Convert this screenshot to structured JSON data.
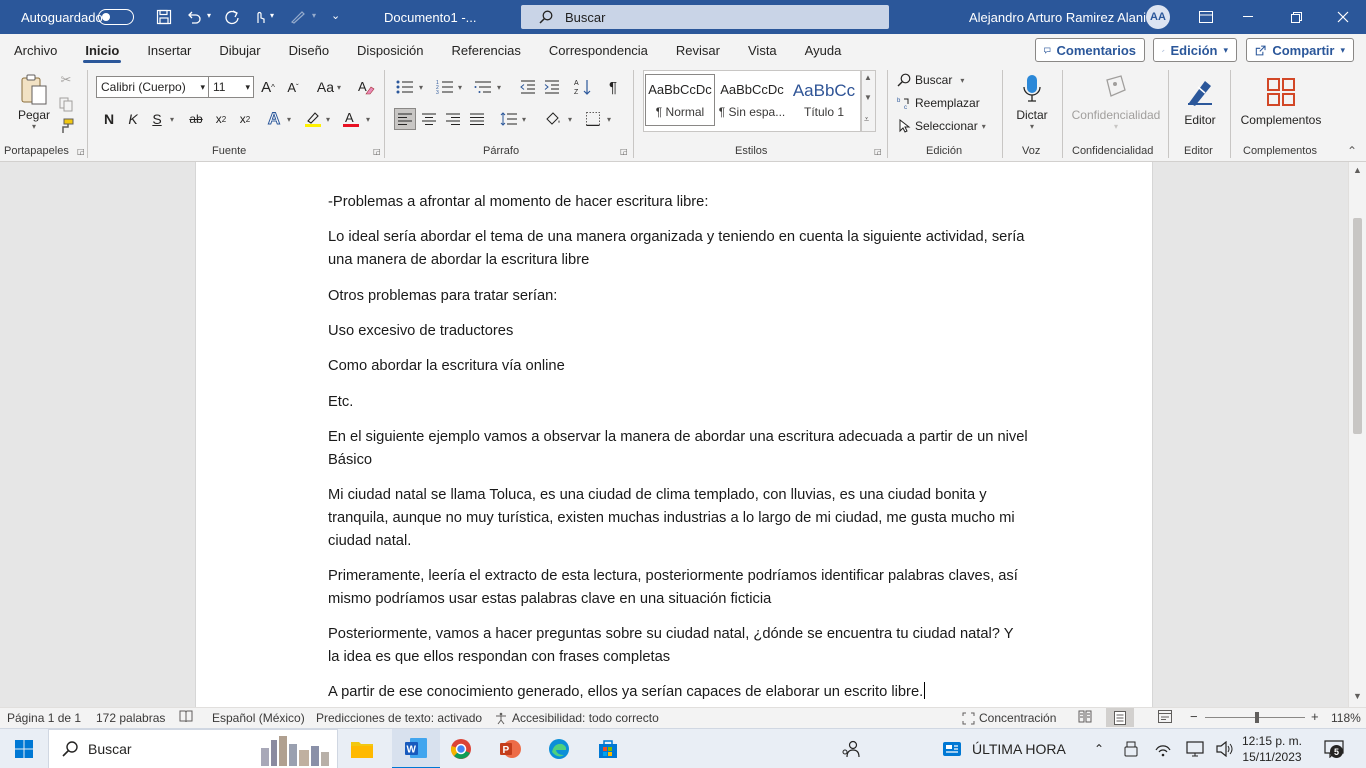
{
  "titlebar": {
    "autosave_label": "Autoguardado",
    "doc_title": "Documento1  -...",
    "search_placeholder": "Buscar",
    "user_name": "Alejandro Arturo Ramirez Alanis",
    "user_initials": "AA",
    "accent": "#2b579a"
  },
  "menu": {
    "tabs": [
      "Archivo",
      "Inicio",
      "Insertar",
      "Dibujar",
      "Diseño",
      "Disposición",
      "Referencias",
      "Correspondencia",
      "Revisar",
      "Vista",
      "Ayuda"
    ],
    "active_tab": "Inicio",
    "comments_label": "Comentarios",
    "editing_label": "Edición",
    "share_label": "Compartir"
  },
  "ribbon": {
    "paste_label": "Pegar",
    "font_name": "Calibri (Cuerpo)",
    "font_size": "11",
    "bold": "N",
    "italic": "K",
    "underline": "S",
    "case_label": "Aa",
    "styles": [
      {
        "preview": "AaBbCcDc",
        "label": "¶ Normal"
      },
      {
        "preview": "AaBbCcDc",
        "label": "¶ Sin espa..."
      },
      {
        "preview": "AaBbCc",
        "label": "Título 1"
      }
    ],
    "find_label": "Buscar",
    "replace_label": "Reemplazar",
    "select_label": "Seleccionar",
    "dictate_label": "Dictar",
    "sensitivity_label": "Confidencialidad",
    "editor_label": "Editor",
    "addins_label": "Complementos",
    "groups": {
      "clipboard": "Portapapeles",
      "font": "Fuente",
      "paragraph": "Párrafo",
      "styles": "Estilos",
      "editing": "Edición",
      "voice": "Voz",
      "sensitivity": "Confidencialidad",
      "editor": "Editor",
      "addins": "Complementos"
    }
  },
  "document": {
    "paragraphs": [
      "-Problemas a afrontar al momento de hacer escritura libre:",
      "Lo ideal sería abordar el tema de una manera organizada y teniendo en cuenta la siguiente actividad, sería una manera de abordar la escritura libre",
      "Otros problemas para tratar serían:",
      "Uso excesivo de traductores",
      "Como abordar la escritura vía online",
      "Etc.",
      "En el siguiente ejemplo vamos a observar la manera de abordar una escritura adecuada a partir de un nivel Básico",
      "Mi ciudad natal se llama Toluca, es una ciudad de clima templado, con lluvias, es una ciudad bonita y tranquila, aunque no muy turística, existen muchas industrias a lo largo de mi ciudad, me gusta mucho mi ciudad natal.",
      "Primeramente, leería el extracto de esta lectura, posteriormente podríamos identificar palabras claves, así mismo podríamos usar estas palabras clave en una situación ficticia",
      "Posteriormente, vamos a hacer preguntas sobre su ciudad natal, ¿dónde se encuentra tu ciudad natal?  Y la idea es que ellos respondan con frases completas",
      "A partir de ese conocimiento generado, ellos ya serían capaces de elaborar un escrito libre."
    ]
  },
  "status": {
    "page": "Página 1 de 1",
    "words": "172 palabras",
    "language": "Español (México)",
    "predictions": "Predicciones de texto: activado",
    "accessibility": "Accesibilidad: todo correcto",
    "focus": "Concentración",
    "zoom": "118%"
  },
  "taskbar": {
    "search_label": "Buscar",
    "news_label": "ÚLTIMA HORA",
    "time": "12:15 p. m.",
    "date": "15/11/2023",
    "notifications": "5"
  }
}
